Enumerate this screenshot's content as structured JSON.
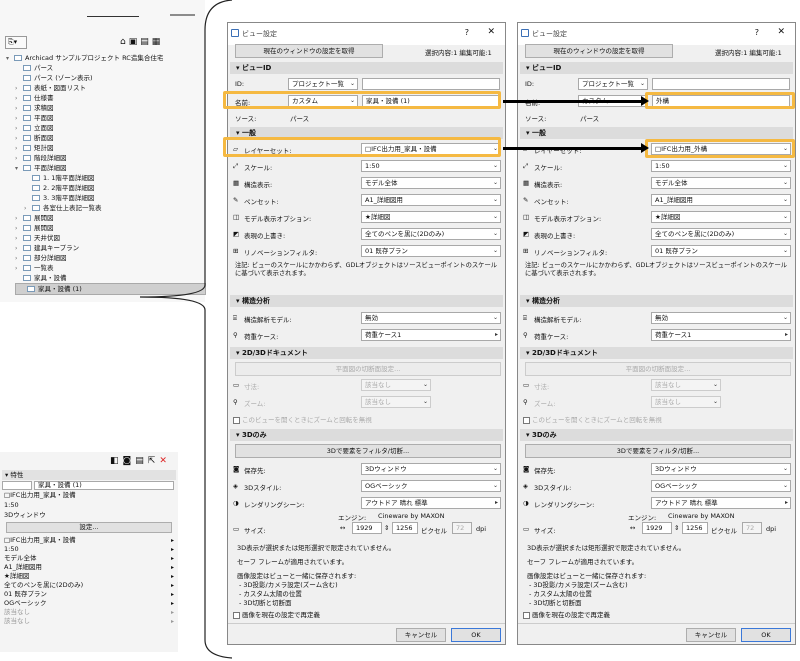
{
  "navigator": {
    "tree": [
      {
        "label": "Archicad サンプルプロジェクト RC造集合住宅",
        "indent": 0,
        "tri": "▾"
      },
      {
        "label": "パース",
        "indent": 1,
        "tri": ""
      },
      {
        "label": "パース (ゾーン表示)",
        "indent": 1,
        "tri": ""
      },
      {
        "label": "表紙・図面リスト",
        "indent": 1,
        "tri": "›"
      },
      {
        "label": "仕様書",
        "indent": 1,
        "tri": "›"
      },
      {
        "label": "求積図",
        "indent": 1,
        "tri": "›"
      },
      {
        "label": "平面図",
        "indent": 1,
        "tri": "›"
      },
      {
        "label": "立面図",
        "indent": 1,
        "tri": "›"
      },
      {
        "label": "断面図",
        "indent": 1,
        "tri": "›"
      },
      {
        "label": "矩計図",
        "indent": 1,
        "tri": "›"
      },
      {
        "label": "階段詳細図",
        "indent": 1,
        "tri": "›"
      },
      {
        "label": "平面詳細図",
        "indent": 1,
        "tri": "▾"
      },
      {
        "label": "1. 1階平面詳細図",
        "indent": 2,
        "tri": ""
      },
      {
        "label": "2. 2階平面詳細図",
        "indent": 2,
        "tri": ""
      },
      {
        "label": "3. 3階平面詳細図",
        "indent": 2,
        "tri": ""
      },
      {
        "label": "各室仕上表記一覧表",
        "indent": 2,
        "tri": "›"
      },
      {
        "label": "展開図",
        "indent": 1,
        "tri": "›"
      },
      {
        "label": "展開図",
        "indent": 1,
        "tri": "›"
      },
      {
        "label": "天井伏図",
        "indent": 1,
        "tri": "›"
      },
      {
        "label": "建具キープラン",
        "indent": 1,
        "tri": "›"
      },
      {
        "label": "部分詳細図",
        "indent": 1,
        "tri": "›"
      },
      {
        "label": "一覧表",
        "indent": 1,
        "tri": "›"
      },
      {
        "label": "家具・設備",
        "indent": 1,
        "tri": ""
      },
      {
        "label": "家具・設備 (1)",
        "indent": 1,
        "tri": ""
      }
    ]
  },
  "properties": {
    "header": "特性",
    "name_value": "家具・設備 (1)",
    "layer": "□IFC出力用_家具・設備",
    "scale": "1:50",
    "window": "3Dウィンドウ",
    "settings_btn": "設定...",
    "rows": [
      "□IFC出力用_家具・設備",
      "1:50",
      "モデル全体",
      "A1_詳細図用",
      "★詳細図",
      "全てのペンを黒に(2Dのみ)",
      "01 既存プラン",
      "OGベーシック",
      "該当なし",
      "該当なし"
    ]
  },
  "dialog_left": {
    "title": "ビュー設定",
    "get_btn": "現在のウィンドウの設定を取得",
    "selection": "選択内容:1 編集可能:1",
    "sec_viewid": "ビューID",
    "id_label": "ID:",
    "id_value": "プロジェクト一覧",
    "name_label": "名前:",
    "name_mode": "カスタム",
    "name_value": "家具・設備 (1)",
    "source_label": "ソース:",
    "source_value": "パース",
    "sec_general": "一般",
    "layerset_label": "レイヤーセット:",
    "layerset_value": "□IFC出力用_家具・設備",
    "scale_label": "スケール:",
    "scale_value": "1:50",
    "struct_label": "構造表示:",
    "struct_value": "モデル全体",
    "penset_label": "ペンセット:",
    "penset_value": "A1_詳細図用",
    "mvo_label": "モデル表示オプション:",
    "mvo_value": "★詳細図",
    "override_label": "表現の上書き:",
    "override_value": "全てのペンを黒に(2Dのみ)",
    "reno_label": "リノベーションフィルタ:",
    "reno_value": "01 既存プラン",
    "note": "注記: ビューのスケールにかかわらず、GDLオブジェクトはソースビューポイントのスケールに基づいて表示されます。",
    "sec_struct": "構造分析",
    "analytic_label": "構造解析モデル:",
    "analytic_value": "無効",
    "load_label": "荷重ケース:",
    "load_value": "荷重ケース1",
    "sec_2d3d": "2D/3Dドキュメント",
    "cutplane_btn": "平面図の切断面設定...",
    "dim_label": "寸法:",
    "dim_value": "該当なし",
    "zoom_label": "ズーム:",
    "zoom_value": "該当なし",
    "ignore_zoom": "このビューを開くときにズームと回転を無視",
    "sec_3donly": "3Dのみ",
    "filter_btn": "3Dで要素をフィルタ/切断...",
    "save_label": "保存先:",
    "save_value": "3Dウィンドウ",
    "style_label": "3Dスタイル:",
    "style_value": "OGベーシック",
    "render_label": "レンダリングシーン:",
    "render_value": "アウトドア 晴れ 標準",
    "engine_label": "エンジン:",
    "engine_value": "Cineware by MAXON",
    "size_label": "サイズ:",
    "size_w": "1929",
    "size_h": "1256",
    "size_unit": "ピクセル",
    "dpi_value": "72",
    "dpi_unit": "dpi",
    "info1": "3D表示が選択または矩形選択で限定されていません。",
    "info2": "セーフ フレームが適用されています。",
    "info3": "画像設定はビューと一緒に保存されます:",
    "info4": "- 3D投影/カメラ設定(ズーム含む)",
    "info5": "- カスタム太陽の位置",
    "info6": "- 3D切断と切断面",
    "redefine": "画像を現在の設定で再定義",
    "cancel": "キャンセル",
    "ok": "OK"
  },
  "dialog_right": {
    "title": "ビュー設定",
    "get_btn": "現在のウィンドウの設定を取得",
    "selection": "選択内容:1 編集可能:1",
    "sec_viewid": "ビューID",
    "id_label": "ID:",
    "id_value": "プロジェクト一覧",
    "name_label": "名前:",
    "name_mode": "カスタム",
    "name_value": "外構",
    "source_label": "ソース:",
    "source_value": "パース",
    "sec_general": "一般",
    "layerset_label": "レイヤーセット:",
    "layerset_value": "□IFC出力用_外構",
    "scale_label": "スケール:",
    "scale_value": "1:50",
    "struct_label": "構造表示:",
    "struct_value": "モデル全体",
    "penset_label": "ペンセット:",
    "penset_value": "A1_詳細図用",
    "mvo_label": "モデル表示オプション:",
    "mvo_value": "★詳細図",
    "override_label": "表現の上書き:",
    "override_value": "全てのペンを黒に(2Dのみ)",
    "reno_label": "リノベーションフィルタ:",
    "reno_value": "01 既存プラン",
    "note": "注記: ビューのスケールにかかわらず、GDLオブジェクトはソースビューポイントのスケールに基づいて表示されます。",
    "sec_struct": "構造分析",
    "analytic_label": "構造解析モデル:",
    "analytic_value": "無効",
    "load_label": "荷重ケース:",
    "load_value": "荷重ケース1",
    "sec_2d3d": "2D/3Dドキュメント",
    "cutplane_btn": "平面図の切断面設定...",
    "dim_label": "寸法:",
    "dim_value": "該当なし",
    "zoom_label": "ズーム:",
    "zoom_value": "該当なし",
    "ignore_zoom": "このビューを開くときにズームと回転を無視",
    "sec_3donly": "3Dのみ",
    "filter_btn": "3Dで要素をフィルタ/切断...",
    "save_label": "保存先:",
    "save_value": "3Dウィンドウ",
    "style_label": "3Dスタイル:",
    "style_value": "OGベーシック",
    "render_label": "レンダリングシーン:",
    "render_value": "アウトドア 晴れ 標準",
    "engine_label": "エンジン:",
    "engine_value": "Cineware by MAXON",
    "size_label": "サイズ:",
    "size_w": "1929",
    "size_h": "1256",
    "size_unit": "ピクセル",
    "dpi_value": "72",
    "dpi_unit": "dpi",
    "info1": "3D表示が選択または矩形選択で限定されていません。",
    "info2": "セーフ フレームが適用されています。",
    "info3": "画像設定はビューと一緒に保存されます:",
    "info4": "- 3D投影/カメラ設定(ズーム含む)",
    "info5": "- カスタム太陽の位置",
    "info6": "- 3D切断と切断面",
    "redefine": "画像を現在の設定で再定義",
    "cancel": "キャンセル",
    "ok": "OK"
  },
  "colors": {
    "highlight": "#f5b942",
    "accent": "#3b78d8"
  }
}
